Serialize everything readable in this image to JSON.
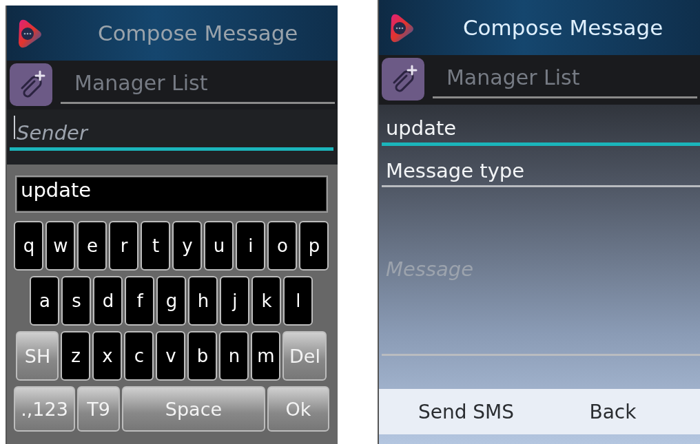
{
  "screens": [
    {
      "kind": "keyboard",
      "title": "Compose Message",
      "recipient": "Manager List",
      "fields": [
        {
          "kind": "single",
          "placeholder": "Sender",
          "focused": true
        }
      ],
      "keyboard": {
        "input": "update",
        "rows": [
          {
            "keys": [
              {
                "label": "q",
                "kind": "letter"
              },
              {
                "label": "w",
                "kind": "letter"
              },
              {
                "label": "e",
                "kind": "letter"
              },
              {
                "label": "r",
                "kind": "letter"
              },
              {
                "label": "t",
                "kind": "letter"
              },
              {
                "label": "y",
                "kind": "letter"
              },
              {
                "label": "u",
                "kind": "letter"
              },
              {
                "label": "i",
                "kind": "letter"
              },
              {
                "label": "o",
                "kind": "letter"
              },
              {
                "label": "p",
                "kind": "letter"
              }
            ]
          },
          {
            "keys": [
              {
                "label": "a",
                "kind": "letter"
              },
              {
                "label": "s",
                "kind": "letter"
              },
              {
                "label": "d",
                "kind": "letter"
              },
              {
                "label": "f",
                "kind": "letter"
              },
              {
                "label": "g",
                "kind": "letter"
              },
              {
                "label": "h",
                "kind": "letter"
              },
              {
                "label": "j",
                "kind": "letter"
              },
              {
                "label": "k",
                "kind": "letter"
              },
              {
                "label": "l",
                "kind": "letter"
              }
            ]
          },
          {
            "keys": [
              {
                "label": "SH",
                "kind": "shift"
              },
              {
                "label": "z",
                "kind": "letter"
              },
              {
                "label": "x",
                "kind": "letter"
              },
              {
                "label": "c",
                "kind": "letter"
              },
              {
                "label": "v",
                "kind": "letter"
              },
              {
                "label": "b",
                "kind": "letter"
              },
              {
                "label": "n",
                "kind": "letter"
              },
              {
                "label": "m",
                "kind": "letter"
              },
              {
                "label": "Del",
                "kind": "delete"
              }
            ]
          },
          {
            "keys": [
              {
                "label": ".,123",
                "kind": "symbols"
              },
              {
                "label": "T9",
                "kind": "mode"
              },
              {
                "label": "Space",
                "kind": "space"
              },
              {
                "label": "Ok",
                "kind": "ok"
              }
            ]
          }
        ]
      }
    },
    {
      "kind": "form",
      "title": "Compose Message",
      "recipient": "Manager List",
      "fields": [
        {
          "kind": "single",
          "value": "update",
          "focused": true
        },
        {
          "kind": "single",
          "value": "Message type",
          "focused": false
        },
        {
          "kind": "multi",
          "placeholder": "Message",
          "focused": false
        }
      ],
      "softkeys": [
        "Send SMS",
        "Back"
      ]
    }
  ]
}
